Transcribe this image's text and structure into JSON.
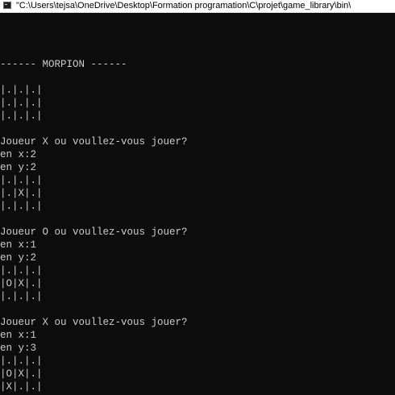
{
  "window": {
    "title": "\"C:\\Users\\tejsa\\OneDrive\\Desktop\\Formation programation\\C\\projet\\game_library\\bin\\",
    "icon": "console-app-icon"
  },
  "console": {
    "lines": [
      "------ MORPION ------",
      "",
      "|.|.|.|",
      "|.|.|.|",
      "|.|.|.|",
      "",
      "Joueur X ou voullez-vous jouer?",
      "en x:2",
      "en y:2",
      "|.|.|.|",
      "|.|X|.|",
      "|.|.|.|",
      "",
      "Joueur O ou voullez-vous jouer?",
      "en x:1",
      "en y:2",
      "|.|.|.|",
      "|O|X|.|",
      "|.|.|.|",
      "",
      "Joueur X ou voullez-vous jouer?",
      "en x:1",
      "en y:3",
      "|.|.|.|",
      "|O|X|.|",
      "|X|.|.|"
    ]
  },
  "colors": {
    "background": "#0c0c0c",
    "foreground": "#cccccc",
    "titlebar": "#ffffff"
  }
}
